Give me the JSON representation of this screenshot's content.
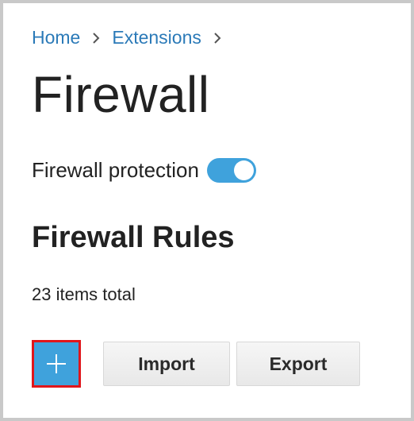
{
  "breadcrumb": {
    "items": [
      {
        "label": "Home"
      },
      {
        "label": "Extensions"
      }
    ]
  },
  "page": {
    "title": "Firewall"
  },
  "protection": {
    "label": "Firewall protection",
    "enabled": true,
    "toggle_color": "#3fa2dc"
  },
  "rules": {
    "title": "Firewall Rules",
    "count_text": "23 items total"
  },
  "toolbar": {
    "add_icon": "plus-icon",
    "add_highlight_color": "#e0161b",
    "import_label": "Import",
    "export_label": "Export"
  },
  "colors": {
    "accent": "#3fa2dc",
    "link": "#2b7ab8"
  }
}
